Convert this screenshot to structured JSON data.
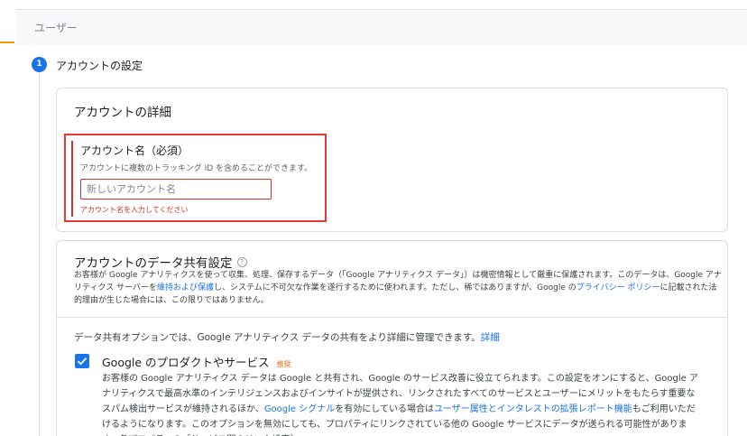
{
  "header": {
    "label": "ユーザー"
  },
  "step": {
    "number": "1",
    "title": "アカウントの設定"
  },
  "account_details": {
    "title": "アカウントの詳細",
    "field_label": "アカウント名（必須）",
    "field_hint": "アカウントに複数のトラッキング ID を含めることができます。",
    "input_value": "",
    "input_placeholder": "新しいアカウント名",
    "error": "アカウント名を入力してください"
  },
  "data_sharing": {
    "title": "アカウントのデータ共有設定",
    "help_icon": "?",
    "desc_part1": "お客様が Google アナリティクスを使って収集、処理、保存するデータ（「Google アナリティクス データ」）は機密情報として厳重に保護されます。このデータは、Google アナリティクス サーバーを",
    "desc_link1": "維持および保護",
    "desc_part2": "し、システムに不可欠な作業を遂行するために使われます。ただし、稀ではありますが、Google の",
    "desc_link2": "プライバシー ポリシー",
    "desc_part3": "に記載された法的理由が生じた場合には、この限りではありません。",
    "options_text": "データ共有オプションでは、Google アナリティクス データの共有をより詳細に管理できます。",
    "options_link": "詳細",
    "option1": {
      "checked": true,
      "title": "Google のプロダクトやサービス",
      "badge": "推奨",
      "desc_part1": "お客様の Google アナリティクス データは Google と共有され、Google のサービス改善に役立てられます。この設定をオンにすると、Google アナリティクスで最高水準のインテリジェンスおよびインサイトが提供され、リンクされたすべてのサービスとユーザーにメリットをもたらす重要なスパム検出サービスが維持されるほか、",
      "desc_link1": "Google シグナル",
      "desc_part2": "を有効にしている場合は",
      "desc_link2": "ユーザー属性とインタレストの拡張レポート機能",
      "desc_part3": "もご利用いただけるようになります。このオプションを無効にしても、プロパティにリンクされている他の Google サービスにデータが送られる可能性があります。各プロパティの［サービス間のリンク設定］"
    }
  },
  "colors": {
    "accent": "#1a73e8",
    "error": "#d93025",
    "highlight": "#e53935",
    "badge": "#e8710a"
  }
}
